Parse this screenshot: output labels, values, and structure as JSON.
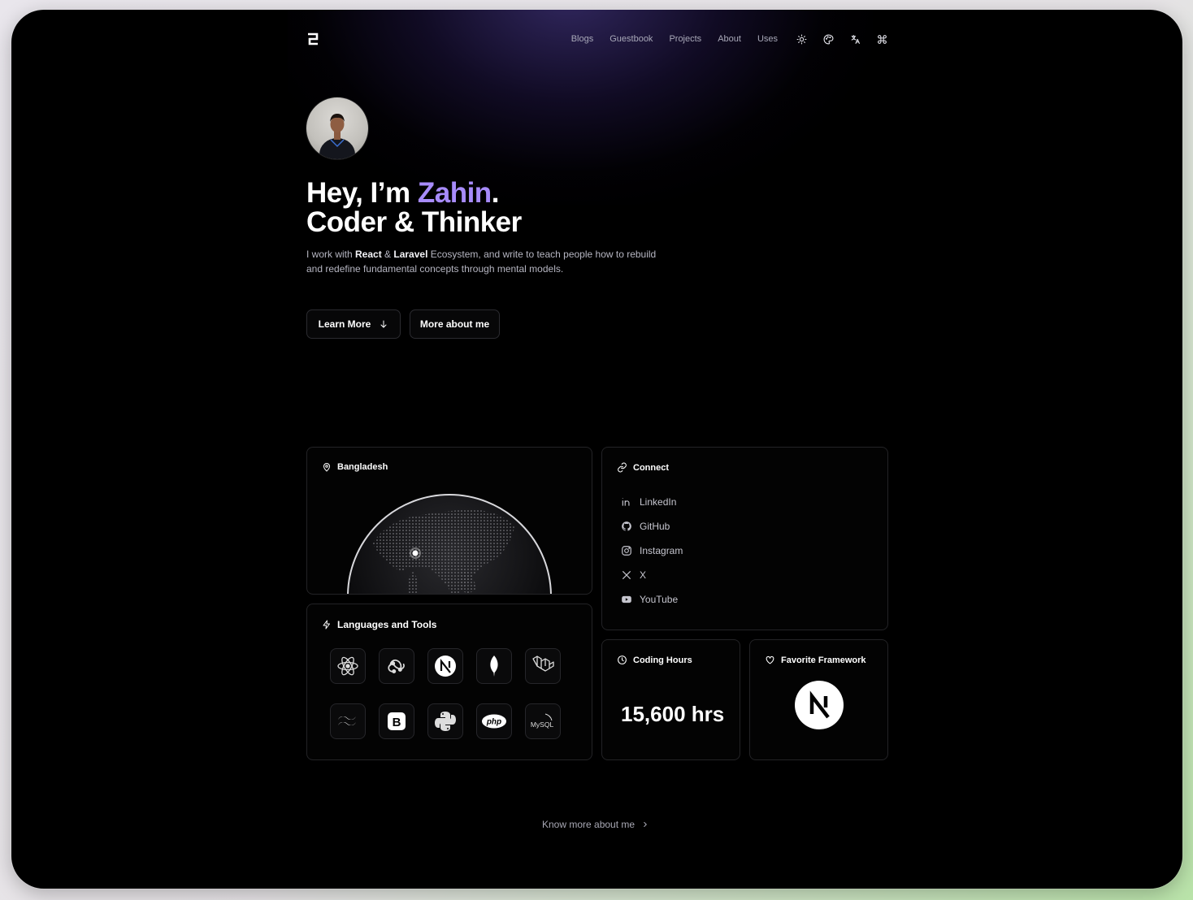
{
  "nav": {
    "links": [
      "Blogs",
      "Guestbook",
      "Projects",
      "About",
      "Uses"
    ],
    "icons": [
      "sun-icon",
      "palette-icon",
      "translate-icon",
      "command-icon"
    ]
  },
  "hero": {
    "line1_prefix": "Hey, I’m ",
    "name": "Zahin",
    "line1_suffix": ".",
    "line2": "Coder & Thinker",
    "desc_1": "I work with ",
    "desc_react": "React",
    "desc_2": " & ",
    "desc_laravel": "Laravel",
    "desc_3": " Ecosystem, and write to teach people how to rebuild and redefine fundamental concepts through mental models.",
    "learn_more": "Learn More",
    "more_about": "More about me"
  },
  "location": {
    "label": "Bangladesh"
  },
  "connect": {
    "label": "Connect",
    "items": [
      "LinkedIn",
      "GitHub",
      "Instagram",
      "X",
      "YouTube"
    ]
  },
  "tools": {
    "label": "Languages and Tools",
    "items": [
      "react-icon",
      "redux-icon",
      "nextjs-icon",
      "mongodb-icon",
      "laravel-icon",
      "tailwind-icon",
      "bootstrap-icon",
      "python-icon",
      "php-icon",
      "mysql-icon"
    ],
    "php_text": "php",
    "mysql_text": "MySQL"
  },
  "coding": {
    "label": "Coding Hours",
    "value": "15,600 hrs"
  },
  "framework": {
    "label": "Favorite Framework"
  },
  "footer": {
    "know_more": "Know more about me"
  },
  "colors": {
    "accent": "#a78bfa",
    "background": "#000000"
  }
}
